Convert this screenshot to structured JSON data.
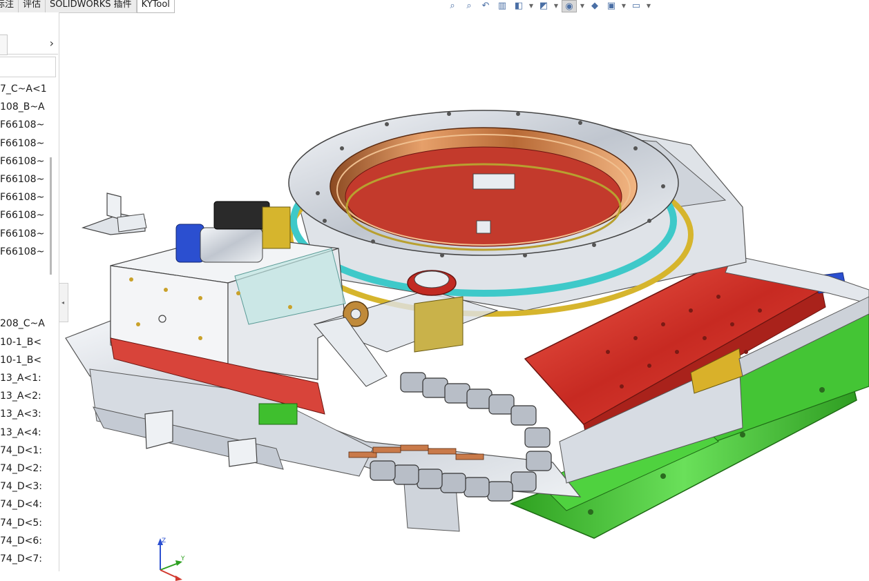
{
  "command_tabs": [
    "标注",
    "评估",
    "SOLIDWORKS 插件",
    "KYTool"
  ],
  "heads_up_toolbar": [
    {
      "icon": "zoom-to-fit-icon",
      "glyph": "⌕"
    },
    {
      "icon": "zoom-to-area-icon",
      "glyph": "⌕"
    },
    {
      "icon": "previous-view-icon",
      "glyph": "↶"
    },
    {
      "icon": "section-view-icon",
      "glyph": "▥"
    },
    {
      "icon": "view-orientation-icon",
      "glyph": "◧"
    },
    {
      "icon": "display-style-icon",
      "glyph": "◩"
    },
    {
      "icon": "hide-show-items-icon",
      "glyph": "◉"
    },
    {
      "icon": "edit-appearance-icon",
      "glyph": "◆"
    },
    {
      "icon": "apply-scene-icon",
      "glyph": "▣"
    },
    {
      "icon": "view-settings-icon",
      "glyph": "▭"
    }
  ],
  "feature_tree": {
    "items": [
      "7_C~A<1",
      "108_B~A",
      "F66108~",
      "F66108~",
      "F66108~",
      "F66108~",
      "F66108~",
      "F66108~",
      "F66108~",
      "F66108~",
      "",
      "",
      "",
      "208_C~A",
      "10-1_B<",
      "10-1_B<",
      "13_A<1:",
      "13_A<2:",
      "13_A<3:",
      "13_A<4:",
      "74_D<1:",
      "74_D<2:",
      "74_D<3:",
      "74_D<4:",
      "74_D<5:",
      "74_D<6:",
      "74_D<7:"
    ]
  },
  "colors": {
    "steel": "#c9ced6",
    "copper": "#c8783f",
    "red_plate": "#d23a30",
    "green_base": "#3fbf2e",
    "cyan_ring": "#3ec9c9",
    "blue_part": "#2a4fd0"
  }
}
